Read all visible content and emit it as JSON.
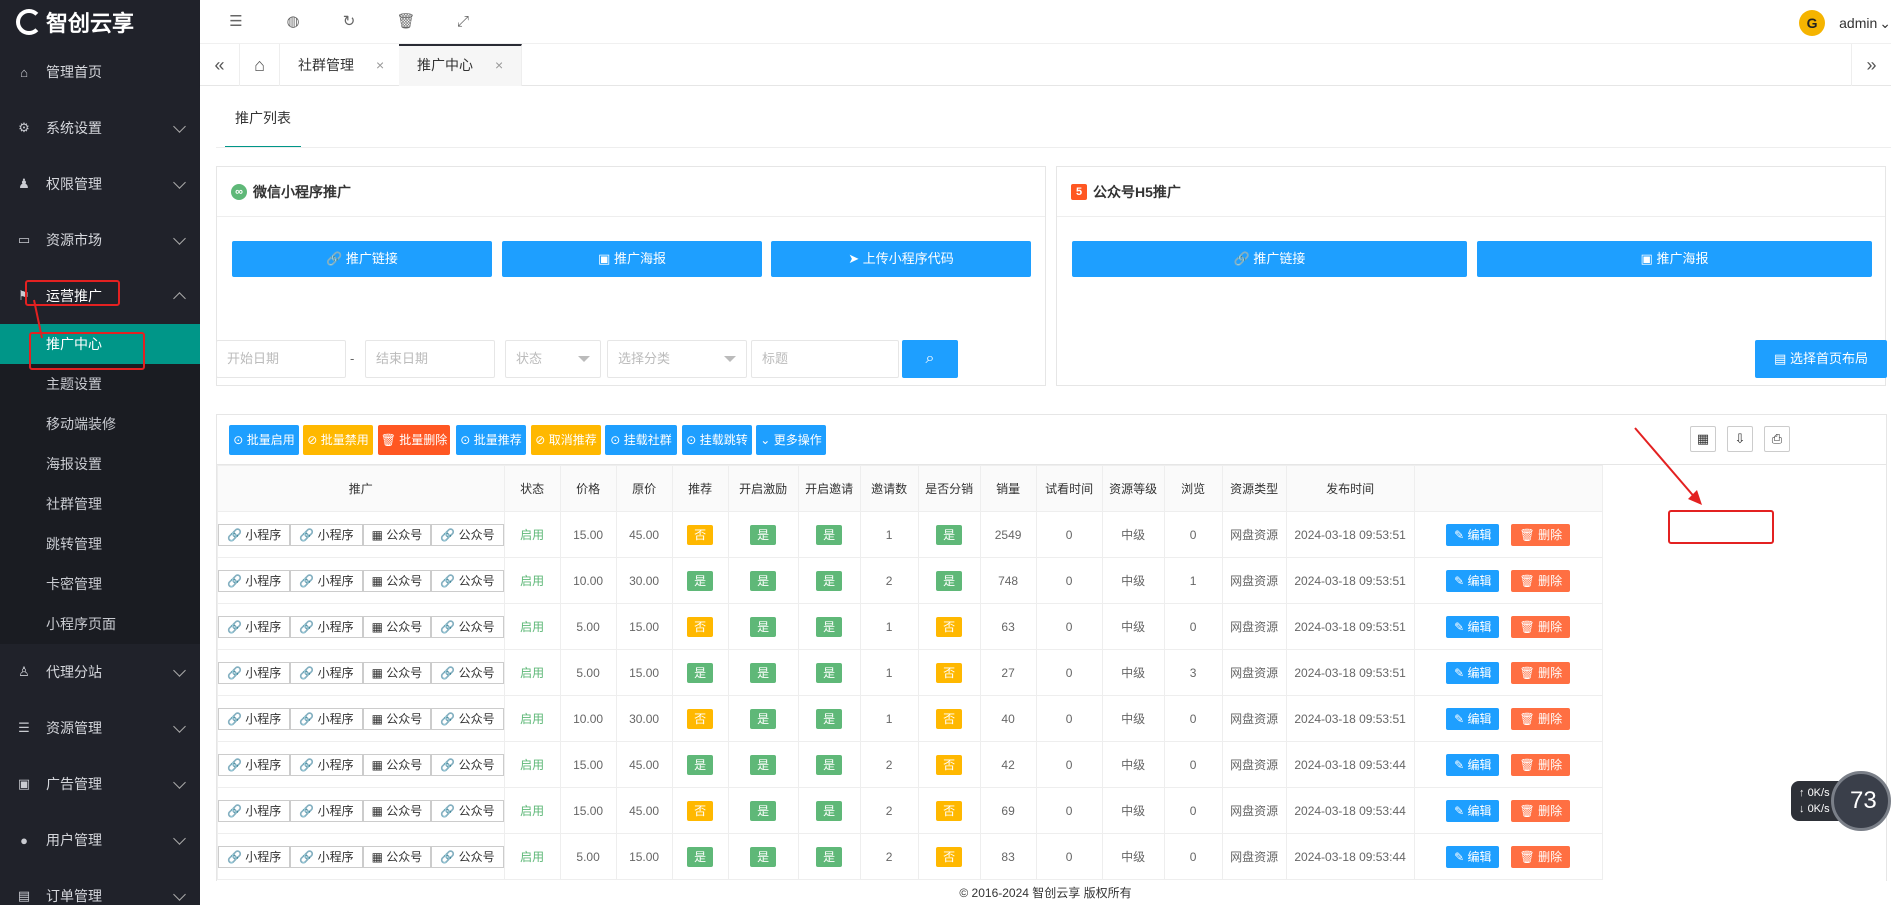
{
  "brand": "智创云享",
  "sidebar": {
    "menu": [
      {
        "label": "管理首页",
        "icon": "home-icon",
        "expandable": false
      },
      {
        "label": "系统设置",
        "icon": "gear-icon",
        "expandable": true
      },
      {
        "label": "权限管理",
        "icon": "users-icon",
        "expandable": true
      },
      {
        "label": "资源市场",
        "icon": "store-icon",
        "expandable": true
      },
      {
        "label": "运营推广",
        "icon": "flag-icon",
        "expandable": true,
        "open": true
      }
    ],
    "submenu": [
      "推广中心",
      "主题设置",
      "移动端装修",
      "海报设置",
      "社群管理",
      "跳转管理",
      "卡密管理",
      "小程序页面"
    ],
    "menu2": [
      {
        "label": "代理分站",
        "icon": "agent-icon"
      },
      {
        "label": "资源管理",
        "icon": "database-icon"
      },
      {
        "label": "广告管理",
        "icon": "ad-icon"
      },
      {
        "label": "用户管理",
        "icon": "user-icon"
      },
      {
        "label": "订单管理",
        "icon": "order-icon"
      }
    ]
  },
  "topbar": {
    "user": "admin"
  },
  "tabs": [
    {
      "label": "社群管理",
      "active": false
    },
    {
      "label": "推广中心",
      "active": true
    }
  ],
  "section_tab": "推广列表",
  "wechat_card": {
    "title": "微信小程序推广",
    "buttons": [
      "推广链接",
      "推广海报",
      "上传小程序代码"
    ]
  },
  "h5_card": {
    "title": "公众号H5推广",
    "buttons": [
      "推广链接",
      "推广海报"
    ]
  },
  "filters": {
    "start": "开始日期",
    "dash": "-",
    "end": "结束日期",
    "status": "状态",
    "category": "选择分类",
    "title": "标题",
    "layout_button": "选择首页布局"
  },
  "toolbar_buttons": [
    {
      "label": "批量启用",
      "color": "blue"
    },
    {
      "label": "批量禁用",
      "color": "orange"
    },
    {
      "label": "批量删除",
      "color": "red"
    },
    {
      "label": "批量推荐",
      "color": "blue"
    },
    {
      "label": "取消推荐",
      "color": "orange"
    },
    {
      "label": "挂载社群",
      "color": "blue"
    },
    {
      "label": "挂载跳转",
      "color": "blue"
    },
    {
      "label": "更多操作",
      "color": "blue"
    }
  ],
  "table": {
    "headers": [
      "推广",
      "状态",
      "价格",
      "原价",
      "推荐",
      "开启激励",
      "开启邀请",
      "邀请数",
      "是否分销",
      "销量",
      "试看时间",
      "资源等级",
      "浏览",
      "资源类型",
      "发布时间",
      ""
    ],
    "promo_tags": [
      "小程序",
      "小程序",
      "公众号",
      "公众号"
    ],
    "status_label": "启用",
    "edit_label": "编辑",
    "delete_label": "删除",
    "rows": [
      {
        "price": "15.00",
        "orig": "45.00",
        "rec": "否",
        "inc": "是",
        "inv": "是",
        "invites": "1",
        "dist": "是",
        "sales": "2549",
        "trial": "0",
        "level": "中级",
        "views": "0",
        "type": "网盘资源",
        "time": "2024-03-18 09:53:51"
      },
      {
        "price": "10.00",
        "orig": "30.00",
        "rec": "是",
        "inc": "是",
        "inv": "是",
        "invites": "2",
        "dist": "是",
        "sales": "748",
        "trial": "0",
        "level": "中级",
        "views": "1",
        "type": "网盘资源",
        "time": "2024-03-18 09:53:51"
      },
      {
        "price": "5.00",
        "orig": "15.00",
        "rec": "否",
        "inc": "是",
        "inv": "是",
        "invites": "1",
        "dist": "否",
        "sales": "63",
        "trial": "0",
        "level": "中级",
        "views": "0",
        "type": "网盘资源",
        "time": "2024-03-18 09:53:51"
      },
      {
        "price": "5.00",
        "orig": "15.00",
        "rec": "是",
        "inc": "是",
        "inv": "是",
        "invites": "1",
        "dist": "否",
        "sales": "27",
        "trial": "0",
        "level": "中级",
        "views": "3",
        "type": "网盘资源",
        "time": "2024-03-18 09:53:51"
      },
      {
        "price": "10.00",
        "orig": "30.00",
        "rec": "否",
        "inc": "是",
        "inv": "是",
        "invites": "1",
        "dist": "否",
        "sales": "40",
        "trial": "0",
        "level": "中级",
        "views": "0",
        "type": "网盘资源",
        "time": "2024-03-18 09:53:51"
      },
      {
        "price": "15.00",
        "orig": "45.00",
        "rec": "是",
        "inc": "是",
        "inv": "是",
        "invites": "2",
        "dist": "否",
        "sales": "42",
        "trial": "0",
        "level": "中级",
        "views": "0",
        "type": "网盘资源",
        "time": "2024-03-18 09:53:44"
      },
      {
        "price": "15.00",
        "orig": "45.00",
        "rec": "否",
        "inc": "是",
        "inv": "是",
        "invites": "2",
        "dist": "否",
        "sales": "69",
        "trial": "0",
        "level": "中级",
        "views": "0",
        "type": "网盘资源",
        "time": "2024-03-18 09:53:44"
      },
      {
        "price": "5.00",
        "orig": "15.00",
        "rec": "是",
        "inc": "是",
        "inv": "是",
        "invites": "2",
        "dist": "否",
        "sales": "83",
        "trial": "0",
        "level": "中级",
        "views": "0",
        "type": "网盘资源",
        "time": "2024-03-18 09:53:44"
      }
    ]
  },
  "footer": "© 2016-2024 智创云享 版权所有",
  "speed_widget": {
    "up": "0K/s",
    "down": "0K/s",
    "value": "73"
  },
  "colors": {
    "sidebar": "#20222a",
    "active_sub": "#009688",
    "primary": "#1e9fff",
    "warn": "#ffb800",
    "danger": "#ff5722",
    "success": "#5fb878",
    "annotation": "#e32121"
  }
}
